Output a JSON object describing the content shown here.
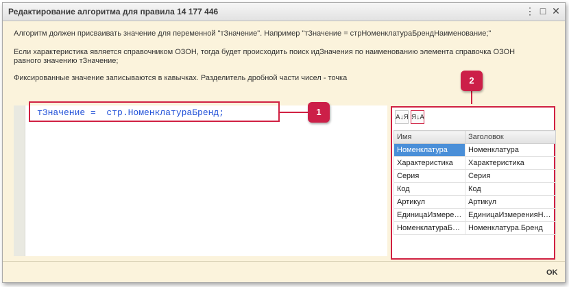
{
  "window": {
    "title": "Редактирование алгоритма для правила 14 177 446",
    "buttons": {
      "more": "⋮",
      "maximize": "□",
      "close": "✕"
    }
  },
  "description": {
    "line1": "Алгоритм должен присваивать значение для переменной \"тЗначение\". Например \"тЗначение = стрНоменклатураБрендНаименование;\"",
    "line2a": "Если характеристика является справочником ОЗОН, тогда будет происходить поиск идЗначения по наименованию элемента справочка ОЗОН",
    "line2b": "равного значению тЗначение;",
    "line3": "Фиксированные значение записываются в кавычках. Разделитель дробной части чисел - точка"
  },
  "editor": {
    "code": "тЗначение =  стр.НоменклатураБренд;"
  },
  "callouts": {
    "one": "1",
    "two": "2"
  },
  "panel": {
    "sort_asc_label": "А↓Я",
    "sort_desc_label": "Я↓А",
    "columns": [
      "Имя",
      "Заголовок"
    ],
    "rows": [
      [
        "Номенклатура",
        "Номенклатура"
      ],
      [
        "Характеристика",
        "Характеристика"
      ],
      [
        "Серия",
        "Серия"
      ],
      [
        "Код",
        "Код"
      ],
      [
        "Артикул",
        "Артикул"
      ],
      [
        "ЕдиницаИзмерен...",
        "ЕдиницаИзмеренияНо..."
      ],
      [
        "НоменклатураБрен...",
        "Номенклатура.Бренд"
      ]
    ]
  },
  "footer": {
    "ok": "OK"
  },
  "colors": {
    "background": "#fbf3dc",
    "highlight": "#d02042",
    "code": "#2050d8",
    "selection": "#4a8fd8"
  }
}
